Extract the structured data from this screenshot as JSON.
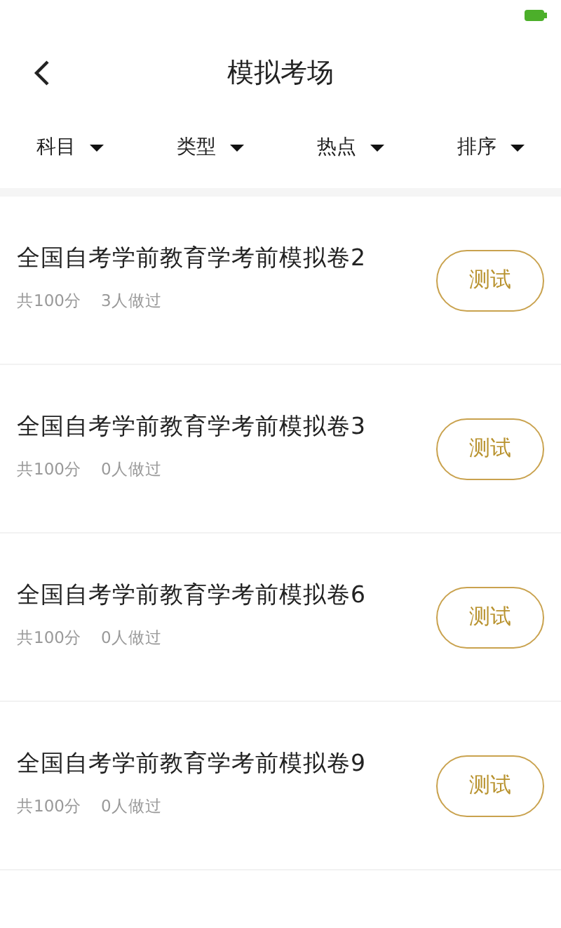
{
  "header": {
    "title": "模拟考场"
  },
  "filters": [
    {
      "label": "科目"
    },
    {
      "label": "类型"
    },
    {
      "label": "热点"
    },
    {
      "label": "排序"
    }
  ],
  "papers": [
    {
      "title": "全国自考学前教育学考前模拟卷2",
      "score": "共100分",
      "done": "3人做过",
      "button": "测试"
    },
    {
      "title": "全国自考学前教育学考前模拟卷3",
      "score": "共100分",
      "done": "0人做过",
      "button": "测试"
    },
    {
      "title": "全国自考学前教育学考前模拟卷6",
      "score": "共100分",
      "done": "0人做过",
      "button": "测试"
    },
    {
      "title": "全国自考学前教育学考前模拟卷9",
      "score": "共100分",
      "done": "0人做过",
      "button": "测试"
    }
  ]
}
